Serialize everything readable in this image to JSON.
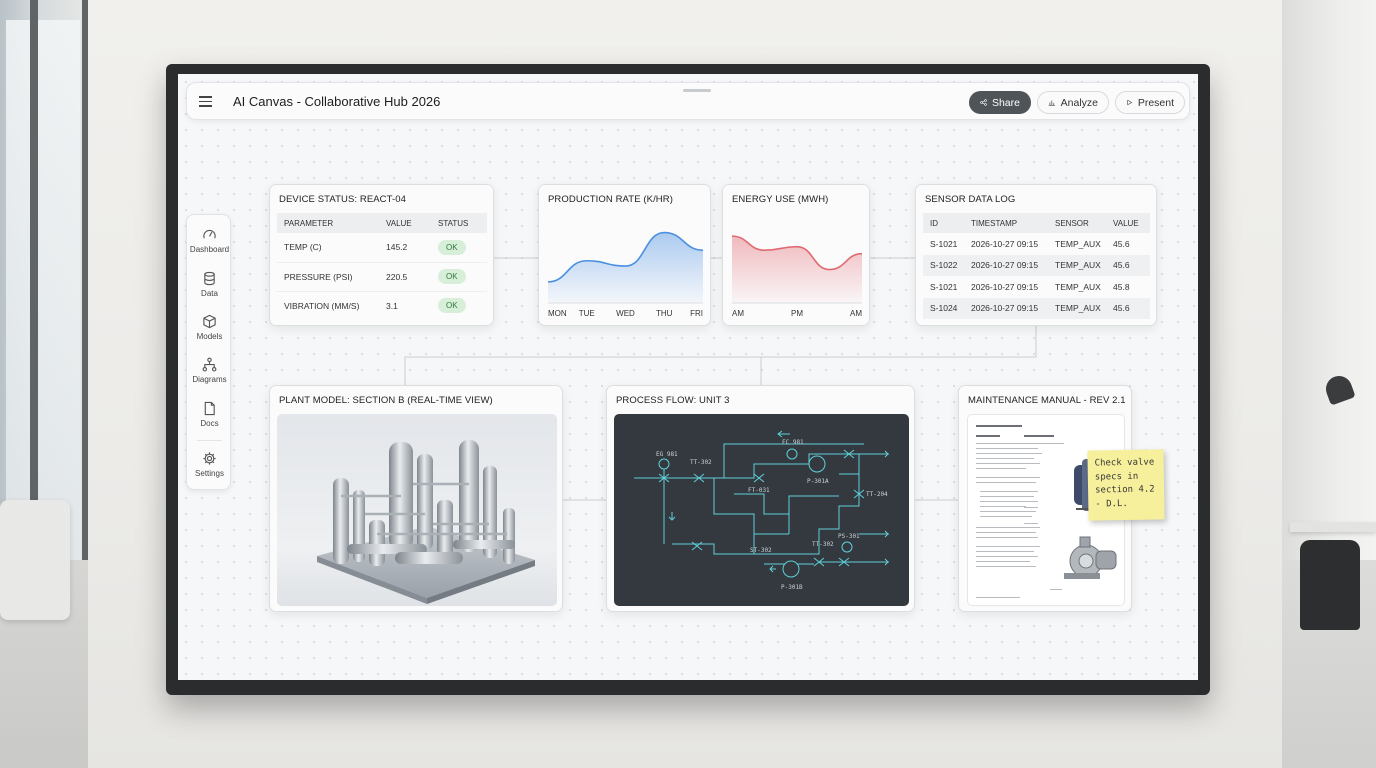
{
  "app": {
    "title": "AI Canvas - Collaborative Hub 2026"
  },
  "toolbar": {
    "share_label": "Share",
    "analyze_label": "Analyze",
    "present_label": "Present"
  },
  "dock": {
    "items": [
      {
        "label": "Dashboard",
        "icon": "gauge-icon"
      },
      {
        "label": "Data",
        "icon": "database-icon"
      },
      {
        "label": "Models",
        "icon": "cube-icon"
      },
      {
        "label": "Diagrams",
        "icon": "diagram-icon"
      },
      {
        "label": "Docs",
        "icon": "document-icon"
      },
      {
        "label": "Settings",
        "icon": "gear-icon"
      }
    ]
  },
  "device_status": {
    "title": "DEVICE STATUS: REACT-04",
    "columns": [
      "PARAMETER",
      "VALUE",
      "STATUS"
    ],
    "rows": [
      {
        "parameter": "TEMP (C)",
        "value": "145.2",
        "status": "OK"
      },
      {
        "parameter": "PRESSURE (PSI)",
        "value": "220.5",
        "status": "OK"
      },
      {
        "parameter": "VIBRATION (MM/S)",
        "value": "3.1",
        "status": "OK"
      }
    ],
    "status_color": "#2f7a3b"
  },
  "production": {
    "title": "PRODUCTION RATE (K/HR)",
    "chart_data": {
      "type": "area",
      "categories": [
        "MON",
        "TUE",
        "WED",
        "THU",
        "FRI"
      ],
      "values": [
        6,
        12,
        10.5,
        20,
        15
      ],
      "ylim": [
        0,
        25
      ],
      "grid": false,
      "color": "#4a8fe0"
    }
  },
  "energy": {
    "title": "ENERGY USE (MWH)",
    "chart_data": {
      "type": "area",
      "categories": [
        "AM",
        "PM",
        "AM"
      ],
      "values": [
        19,
        15,
        16,
        9.5,
        14
      ],
      "ylim": [
        0,
        25
      ],
      "grid": false,
      "color": "#e06a72"
    }
  },
  "sensor_log": {
    "title": "SENSOR DATA LOG",
    "columns": [
      "ID",
      "TIMESTAMP",
      "SENSOR",
      "VALUE"
    ],
    "rows": [
      {
        "id": "S-1021",
        "timestamp": "2026-10-27 09:15",
        "sensor": "TEMP_AUX",
        "value": "45.6"
      },
      {
        "id": "S-1022",
        "timestamp": "2026-10-27 09:15",
        "sensor": "TEMP_AUX",
        "value": "45.6"
      },
      {
        "id": "S-1021",
        "timestamp": "2026-10-27 09:15",
        "sensor": "TEMP_AUX",
        "value": "45.8"
      },
      {
        "id": "S-1024",
        "timestamp": "2026-10-27 09:15",
        "sensor": "TEMP_AUX",
        "value": "45.6"
      }
    ]
  },
  "plant_model": {
    "title": "PLANT MODEL: SECTION B (REAL-TIME VIEW)"
  },
  "process_flow": {
    "title": "PROCESS FLOW: UNIT 3",
    "labels": [
      "EG 981",
      "TT-302",
      "FC 981",
      "FT-031",
      "P-301A",
      "TT-204",
      "TT-302",
      "PS-301",
      "ST-302",
      "P-301B"
    ],
    "line_color": "#5fd0d8"
  },
  "manual": {
    "title": "MAINTENANCE MANUAL - REV 2.1",
    "sticky_note": "Check valve\nspecs in\nsection 4.2\n- D.L.",
    "sticky_color": "#f6ef9b"
  }
}
